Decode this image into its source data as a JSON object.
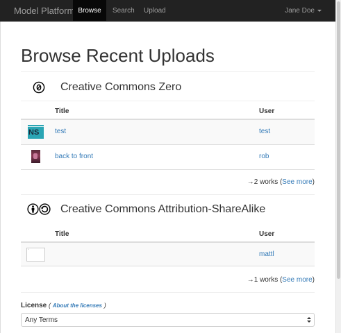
{
  "navbar": {
    "brand": "Model Platform",
    "links": [
      "Browse",
      "Search",
      "Upload"
    ],
    "user": "Jane Doe"
  },
  "page": {
    "title": "Browse Recent Uploads"
  },
  "sections": [
    {
      "license_title": "Creative Commons Zero",
      "icon": "cc-zero-icon",
      "columns": [
        "Title",
        "User"
      ],
      "rows": [
        {
          "title": "test",
          "user": "test",
          "thumb": "NS"
        },
        {
          "title": "back to front",
          "user": "rob"
        }
      ],
      "count_prefix": "→2 works (",
      "see_more": "See more",
      "count_suffix": ")"
    },
    {
      "license_title": "Creative Commons Attribution-ShareAlike",
      "icon": "cc-by-sa-icon",
      "columns": [
        "Title",
        "User"
      ],
      "rows": [
        {
          "title": "",
          "user": "mattl"
        }
      ],
      "count_prefix": "→1 works (",
      "see_more": "See more",
      "count_suffix": ")"
    }
  ],
  "filter": {
    "label": "License",
    "paren_open": "(",
    "about_link": "About the licenses",
    "paren_close": ")",
    "selected": "Any Terms"
  },
  "colors": {
    "navbar_bg": "#222222",
    "link": "#337ab7",
    "active_nav_bg": "#080808"
  }
}
